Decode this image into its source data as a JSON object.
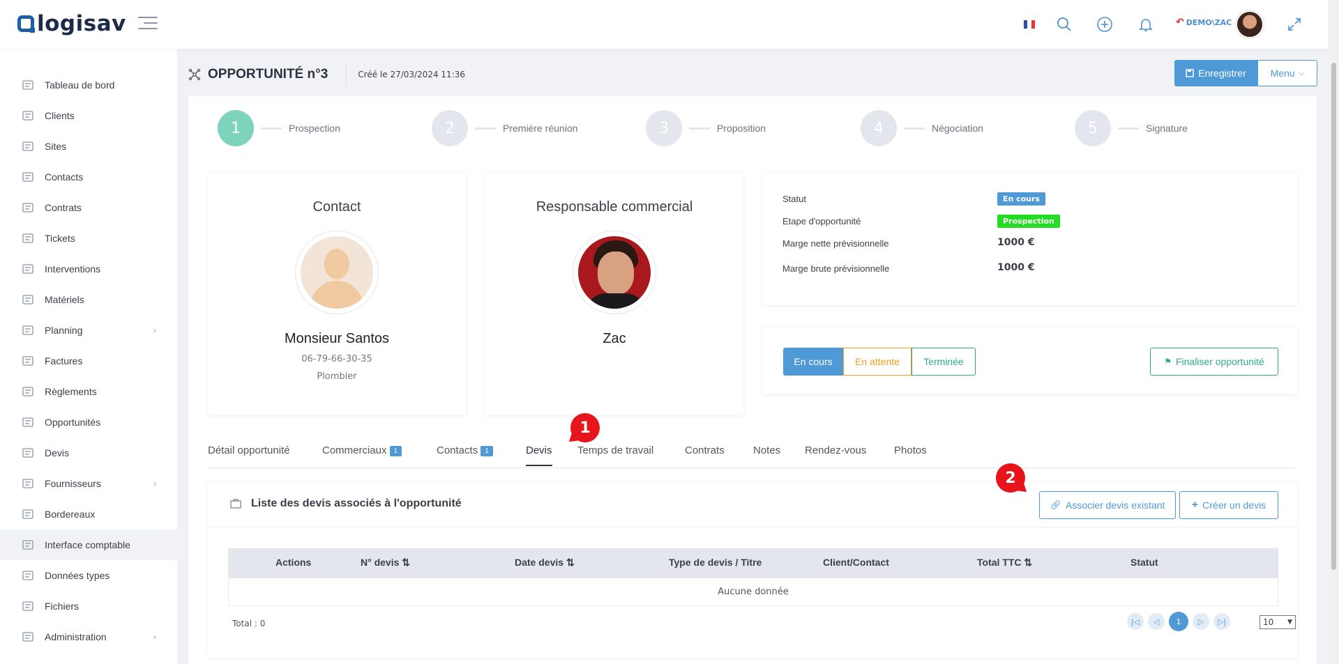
{
  "brand": {
    "name": "logisav"
  },
  "topbar": {
    "user_label": "DEMO\\ZAC"
  },
  "sidebar": {
    "items": [
      {
        "label": "Tableau de bord",
        "icon": "dashboard-icon"
      },
      {
        "label": "Clients",
        "icon": "user-icon"
      },
      {
        "label": "Sites",
        "icon": "location-icon"
      },
      {
        "label": "Contacts",
        "icon": "contact-icon"
      },
      {
        "label": "Contrats",
        "icon": "contract-icon"
      },
      {
        "label": "Tickets",
        "icon": "warning-icon"
      },
      {
        "label": "Interventions",
        "icon": "wrench-icon"
      },
      {
        "label": "Matériels",
        "icon": "box-icon"
      },
      {
        "label": "Planning",
        "icon": "calendar-icon",
        "has_children": true
      },
      {
        "label": "Factures",
        "icon": "invoice-icon"
      },
      {
        "label": "Règlements",
        "icon": "payment-icon"
      },
      {
        "label": "Opportunités",
        "icon": "network-icon"
      },
      {
        "label": "Devis",
        "icon": "folder-icon"
      },
      {
        "label": "Fournisseurs",
        "icon": "truck-icon",
        "has_children": true
      },
      {
        "label": "Bordereaux",
        "icon": "list-icon"
      },
      {
        "label": "Interface comptable",
        "icon": "external-link-icon",
        "active": true
      },
      {
        "label": "Données types",
        "icon": "grid-icon"
      },
      {
        "label": "Fichiers",
        "icon": "file-icon"
      },
      {
        "label": "Administration",
        "icon": "settings-icon",
        "has_children": true
      }
    ]
  },
  "page": {
    "title": "OPPORTUNITÉ n°3",
    "created": "Créé le 27/03/2024 11:36",
    "save_label": "Enregistrer",
    "menu_label": "Menu"
  },
  "steps": [
    {
      "num": "1",
      "label": "Prospection",
      "active": true
    },
    {
      "num": "2",
      "label": "Première réunion"
    },
    {
      "num": "3",
      "label": "Proposition"
    },
    {
      "num": "4",
      "label": "Négociation"
    },
    {
      "num": "5",
      "label": "Signature"
    }
  ],
  "contact": {
    "heading": "Contact",
    "name": "Monsieur Santos",
    "phone": "06-79-66-30-35",
    "job": "Plombier"
  },
  "commercial": {
    "heading": "Responsable commercial",
    "name": "Zac"
  },
  "info": {
    "statut_label": "Statut",
    "statut_value": "En cours",
    "statut_color": "#4f9ad6",
    "etape_label": "Etape d'opportunité",
    "etape_value": "Prospection",
    "etape_color": "#22dd22",
    "marge_nette_label": "Marge nette prévisionnelle",
    "marge_nette_value": "1000 €",
    "marge_brute_label": "Marge brute prévisionnelle",
    "marge_brute_value": "1000 €"
  },
  "status_buttons": {
    "en_cours": "En cours",
    "en_attente": "En attente",
    "terminee": "Terminée",
    "finaliser": "Finaliser opportunité"
  },
  "tabs": [
    {
      "label": "Détail opportunité"
    },
    {
      "label": "Commerciaux",
      "count": "1"
    },
    {
      "label": "Contacts",
      "count": "1"
    },
    {
      "label": "Devis",
      "active": true
    },
    {
      "label": "Temps de travail"
    },
    {
      "label": "Contrats"
    },
    {
      "label": "Notes"
    },
    {
      "label": "Rendez-vous"
    },
    {
      "label": "Photos"
    }
  ],
  "annotations": {
    "pin1": "1",
    "pin2": "2"
  },
  "devis_list": {
    "title": "Liste des devis associés à l'opportunité",
    "associate_label": "Associer devis existant",
    "create_label": "Créer un devis",
    "columns": [
      "Actions",
      "N° devis",
      "Date devis",
      "Type de devis / Titre",
      "Client/Contact",
      "Total TTC",
      "Statut"
    ],
    "empty": "Aucune donnée",
    "total": "Total : 0",
    "current_page": "1",
    "page_size": "10"
  },
  "colors": {
    "accent": "#4f9ad6",
    "step_active": "#7dd3bb",
    "pending": "#f0a020",
    "success": "#2eaa8a",
    "annotation": "#e8141c"
  }
}
